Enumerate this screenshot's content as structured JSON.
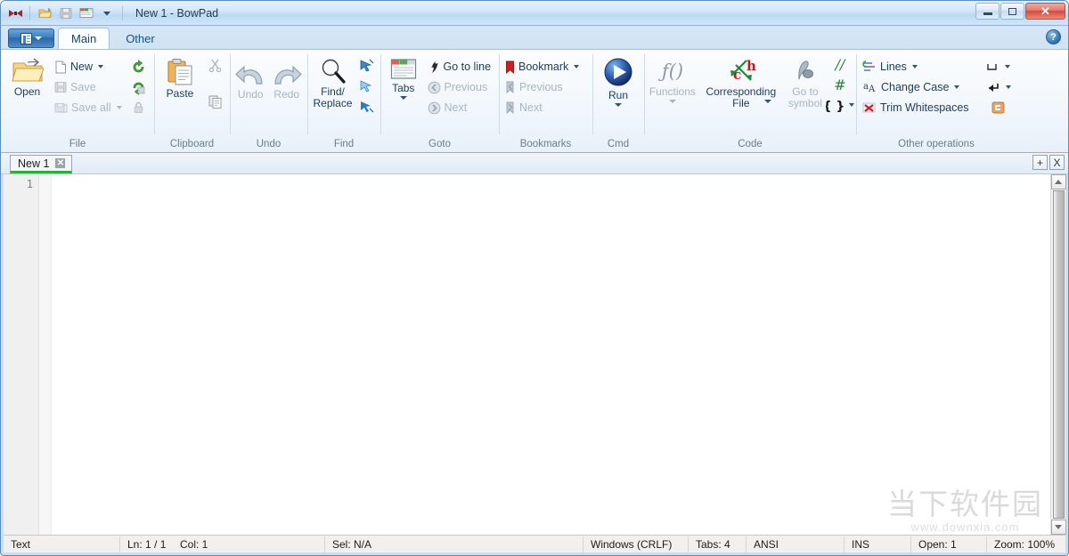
{
  "window": {
    "title": "New 1 - BowPad",
    "app_icon": "bowtie-icon",
    "minimize_label": "Minimize",
    "maximize_label": "Maximize",
    "close_label": "Close"
  },
  "quick_access": {
    "items": [
      {
        "name": "open-icon",
        "label": "Open"
      },
      {
        "name": "save-icon",
        "label": "Save"
      },
      {
        "name": "tabs-icon",
        "label": "Tabs"
      },
      {
        "name": "customize-caret-icon",
        "label": "Customize Quick Access Toolbar"
      }
    ]
  },
  "ribbon": {
    "app_menu_label": "Application Menu",
    "help_label": "?",
    "tabs": [
      {
        "label": "Main",
        "active": true
      },
      {
        "label": "Other",
        "active": false
      }
    ],
    "groups": [
      {
        "label": "File",
        "big": {
          "label": "Open",
          "icon": "open-folder-icon",
          "disabled": false
        },
        "items": [
          {
            "label": "New",
            "icon": "new-file-icon",
            "disabled": false,
            "caret": true
          },
          {
            "label": "Save",
            "icon": "save-disk-icon",
            "disabled": true,
            "caret": false
          },
          {
            "label": "Save all",
            "icon": "save-all-icon",
            "disabled": true,
            "caret": true
          }
        ],
        "extras": [
          {
            "name": "reload-icon",
            "disabled": false
          },
          {
            "name": "reload-save-icon",
            "disabled": false
          },
          {
            "name": "lock-icon",
            "disabled": true
          }
        ]
      },
      {
        "label": "Clipboard",
        "big": {
          "label": "Paste",
          "icon": "paste-icon",
          "disabled": false
        },
        "items": [],
        "extras": [
          {
            "name": "cut-scissors-icon",
            "disabled": true
          },
          {
            "name": "copy-icon",
            "disabled": false
          }
        ]
      },
      {
        "label": "Undo",
        "big": null,
        "items": [],
        "buttons": [
          {
            "label": "Undo",
            "icon": "undo-arrow-icon",
            "disabled": true
          },
          {
            "label": "Redo",
            "icon": "redo-arrow-icon",
            "disabled": true
          }
        ]
      },
      {
        "label": "Find",
        "big": {
          "label": "Find/\nReplace",
          "icon": "magnifier-icon",
          "disabled": false
        },
        "items": [],
        "extras": [
          {
            "name": "find-next-icon",
            "disabled": false
          },
          {
            "name": "find-previous-icon",
            "disabled": false
          },
          {
            "name": "find-all-icon",
            "disabled": false
          }
        ]
      },
      {
        "label": "Goto",
        "big": {
          "label": "Tabs",
          "icon": "tabs-window-icon",
          "disabled": false,
          "caret": true
        },
        "items": [
          {
            "label": "Go to line",
            "icon": "goto-line-icon",
            "disabled": false,
            "caret": false
          },
          {
            "label": "Previous",
            "icon": "previous-circle-icon",
            "disabled": true,
            "caret": false
          },
          {
            "label": "Next",
            "icon": "next-circle-icon",
            "disabled": true,
            "caret": false
          }
        ]
      },
      {
        "label": "Bookmarks",
        "big": null,
        "items": [
          {
            "label": "Bookmark",
            "icon": "bookmark-icon",
            "disabled": false,
            "caret": true
          },
          {
            "label": "Previous",
            "icon": "bookmark-previous-icon",
            "disabled": true,
            "caret": false
          },
          {
            "label": "Next",
            "icon": "bookmark-next-icon",
            "disabled": true,
            "caret": false
          }
        ]
      },
      {
        "label": "Cmd",
        "big": {
          "label": "Run",
          "icon": "run-play-icon",
          "disabled": false,
          "caret": true
        },
        "items": []
      },
      {
        "label": "Code",
        "big": null,
        "buttons": [
          {
            "label": "Functions",
            "icon": "functions-fx-icon",
            "disabled": true,
            "caret": true
          },
          {
            "label": "Corresponding File",
            "icon": "corresponding-file-icon",
            "disabled": false,
            "caret": true
          },
          {
            "label": "Go to symbol",
            "icon": "goto-symbol-icon",
            "disabled": true,
            "caret": false
          }
        ],
        "extras": [
          {
            "name": "comment-slashes-icon",
            "disabled": false
          },
          {
            "name": "comment-hash-icon",
            "disabled": false
          },
          {
            "name": "braces-icon",
            "disabled": false
          }
        ]
      },
      {
        "label": "Other operations",
        "big": null,
        "items": [
          {
            "label": "Lines",
            "icon": "lines-icon",
            "disabled": false,
            "caret": true
          },
          {
            "label": "Change Case",
            "icon": "change-case-icon",
            "disabled": false,
            "caret": true
          },
          {
            "label": "Trim Whitespaces",
            "icon": "trim-whitespaces-icon",
            "disabled": false,
            "caret": false
          }
        ],
        "extras": [
          {
            "name": "show-whitespace-icon",
            "disabled": false,
            "caret": true
          },
          {
            "name": "show-eol-icon",
            "disabled": false,
            "caret": true
          },
          {
            "name": "encoding-icon",
            "disabled": false,
            "caret": false
          }
        ]
      }
    ]
  },
  "tabstrip": {
    "documents": [
      {
        "label": "New 1",
        "active": true,
        "close_label": "✕"
      }
    ],
    "new_tab_label": "+",
    "close_tab_label": "X"
  },
  "editor": {
    "line_numbers": [
      "1"
    ],
    "content": ""
  },
  "statusbar": {
    "cells": [
      {
        "name": "document-type",
        "text": "Text"
      },
      {
        "name": "line-position",
        "text": "Ln: 1 / 1"
      },
      {
        "name": "column-position",
        "text": "Col: 1"
      },
      {
        "name": "selection-info",
        "text": "Sel: N/A"
      },
      {
        "name": "line-endings",
        "text": "Windows (CRLF)"
      },
      {
        "name": "tab-size",
        "text": "Tabs: 4"
      },
      {
        "name": "encoding",
        "text": "ANSI"
      },
      {
        "name": "insert-mode",
        "text": "INS"
      },
      {
        "name": "open-documents",
        "text": "Open: 1"
      },
      {
        "name": "zoom-level",
        "text": "Zoom: 100%"
      }
    ]
  },
  "watermark": {
    "main": "当下软件园",
    "sub": "www.downxia.com"
  },
  "colors": {
    "titlebar_blue": "#d3e7f8",
    "tab_underline_green": "#2bad3a",
    "close_button_red": "#d2483a",
    "accent_blue": "#15518a"
  }
}
